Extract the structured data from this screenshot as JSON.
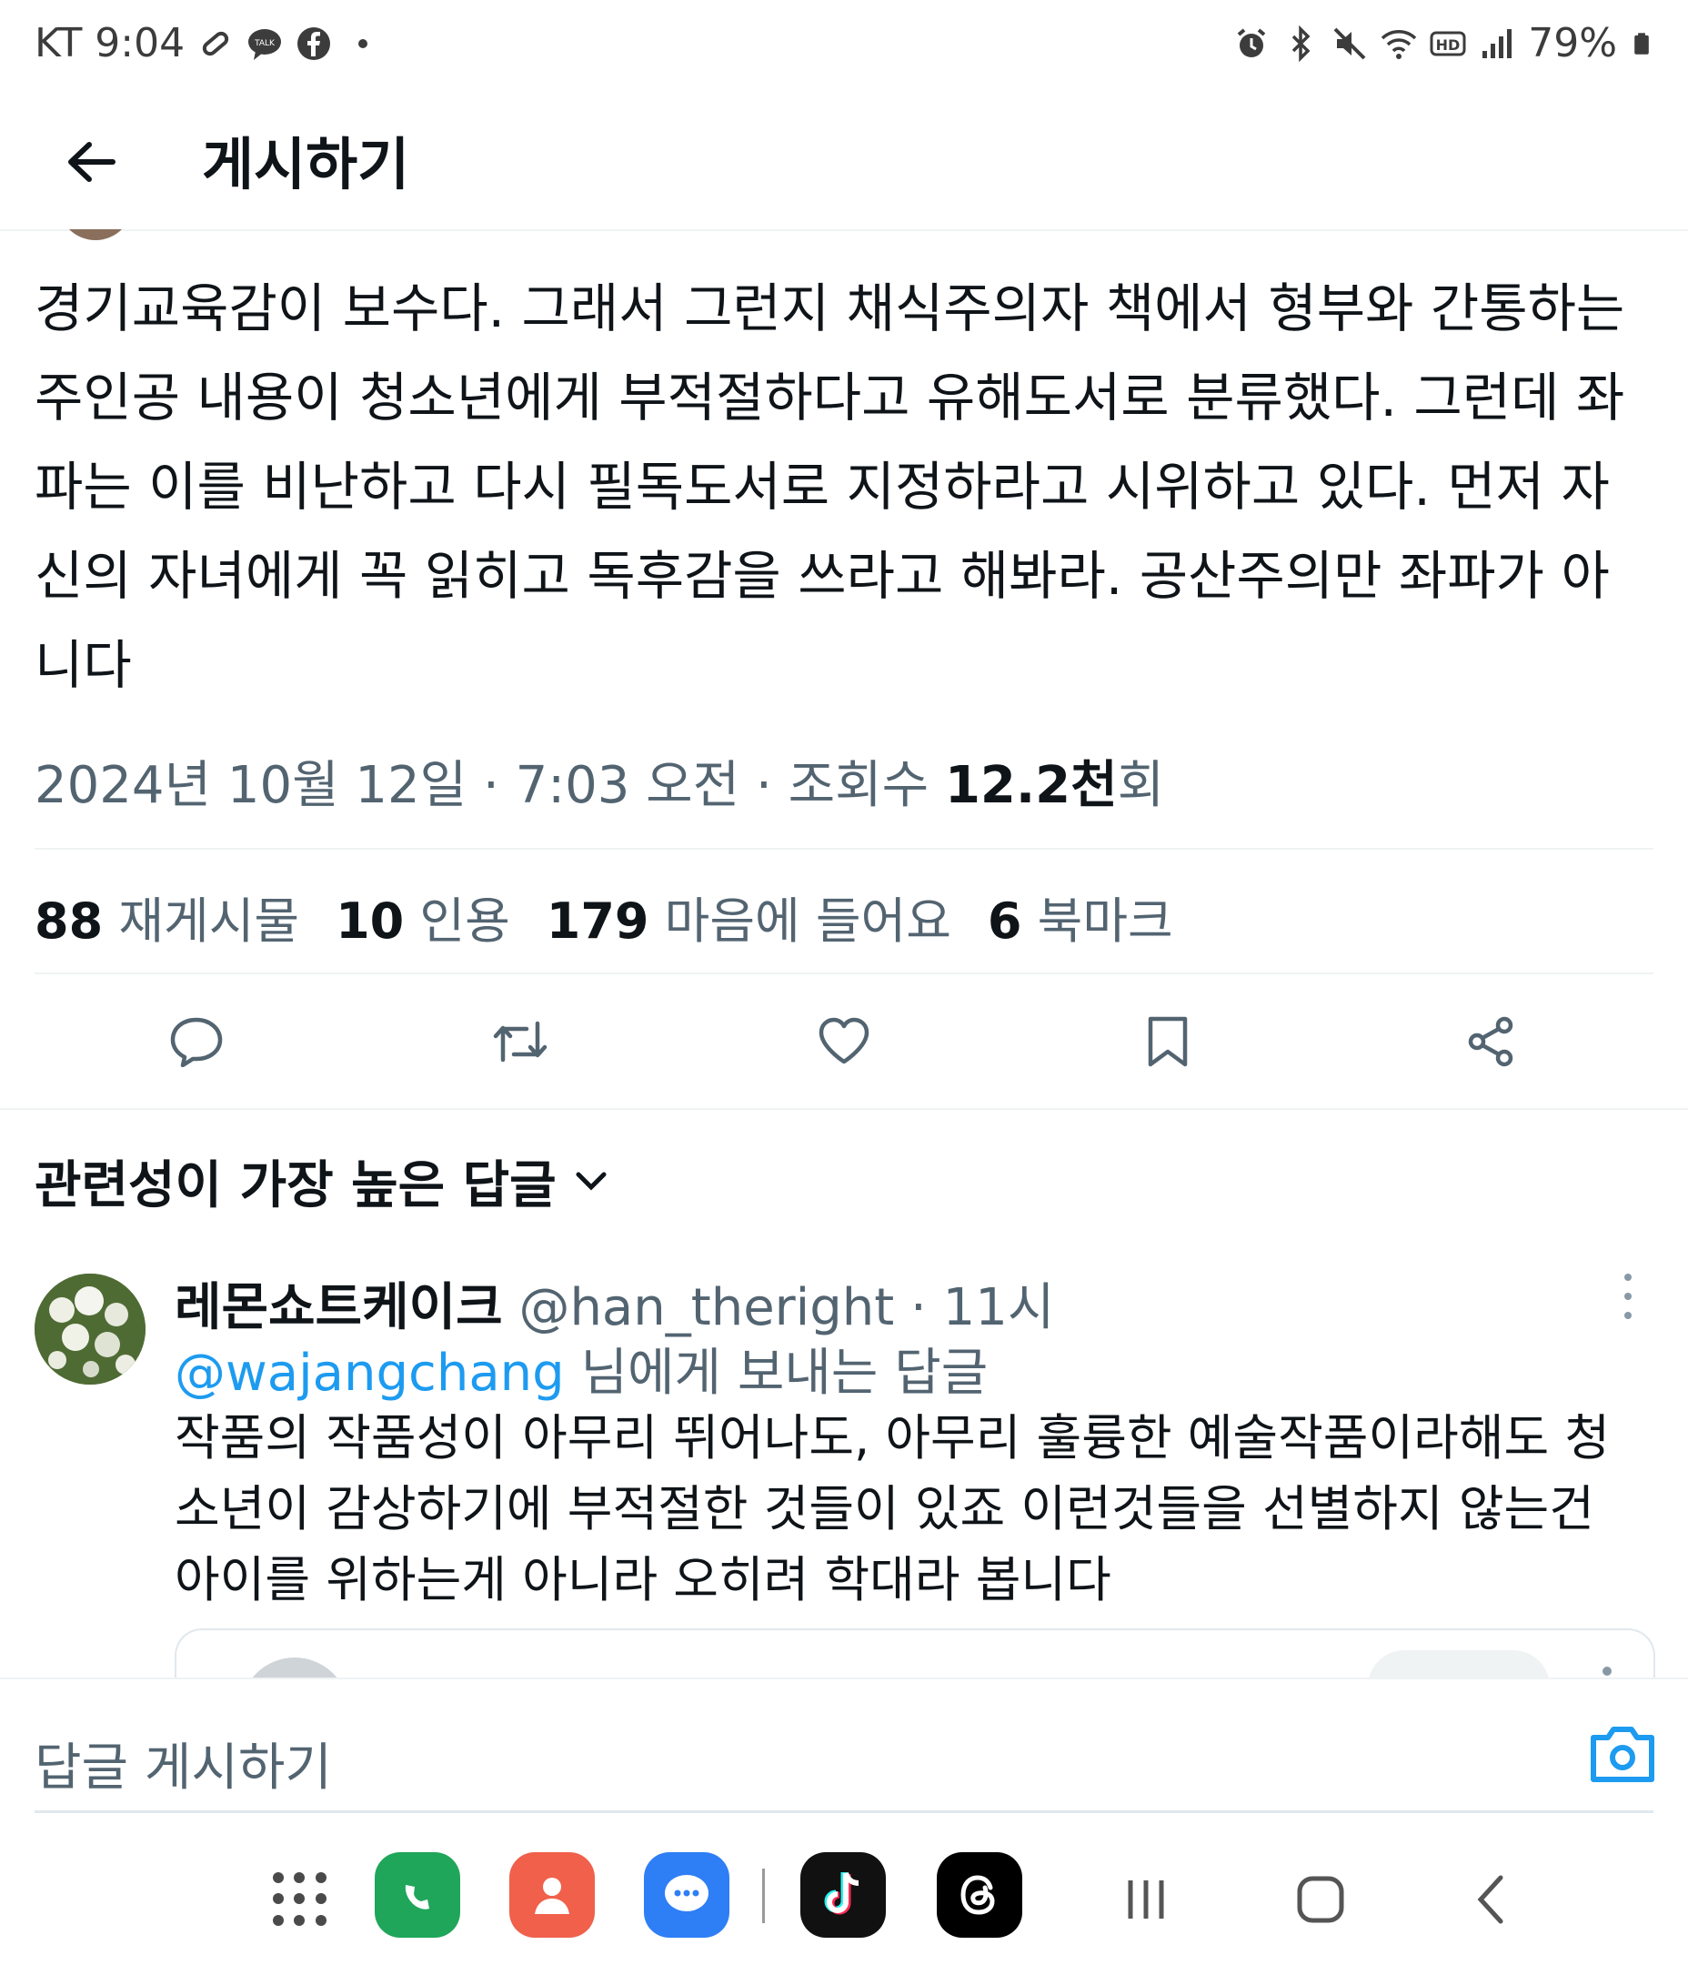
{
  "status_bar": {
    "carrier_time": "KT 9:04",
    "battery": "79%",
    "left_icons": [
      "clip-icon",
      "kakaotalk-icon",
      "facebook-icon",
      "dot-icon"
    ],
    "right_icons": [
      "alarm-icon",
      "bluetooth-icon",
      "mute-icon",
      "wifi-icon",
      "hd-icon",
      "signal-icon",
      "battery-icon"
    ]
  },
  "header": {
    "title": "게시하기"
  },
  "tweet": {
    "text": "경기교육감이 보수다. 그래서 그런지 채식주의자 책에서 형부와 간통하는 주인공 내용이 청소년에게 부적절하다고 유해도서로 분류했다. 그런데 좌파는 이를 비난하고 다시 필독도서로 지정하라고 시위하고 있다. 먼저 자신의 자녀에게 꼭 읽히고 독후감을 쓰라고 해봐라. 공산주의만 좌파가 아니다",
    "meta_prefix": "2024년 10월 12일 · 7:03 오전 · 조회수 ",
    "views": "12.2천",
    "views_suffix": "회",
    "stats": [
      {
        "count": "88",
        "label": "재게시물"
      },
      {
        "count": "10",
        "label": "인용"
      },
      {
        "count": "179",
        "label": "마음에 들어요"
      },
      {
        "count": "6",
        "label": "북마크"
      }
    ]
  },
  "replies": {
    "sort_label": "관련성이 가장 높은 답글"
  },
  "reply": {
    "name": "레몬쇼트케이크",
    "handle_time": " @han_theright · 11시",
    "mention": "@wajangchang",
    "replying_suffix": " 님에게 보내는 답글",
    "text": "작품의 작품성이 아무리 뛰어나도, 아무리 훌륭한 예술작품이라해도 청소년이 감상하기에 부적절한 것들이 있죠 이런것들을 선별하지 않는건 아이를 위하는게 아니라 오히려 학대라 봅니다"
  },
  "compose": {
    "placeholder": "답글 게시하기"
  },
  "colors": {
    "link": "#1d9bf0",
    "secondary_text": "#536471",
    "primary_text": "#0f1419",
    "divider": "#eff3f4"
  },
  "dock": {
    "apps": [
      "phone-app-icon",
      "contacts-app-icon",
      "messages-app-icon",
      "tiktok-app-icon",
      "threads-app-icon"
    ]
  }
}
